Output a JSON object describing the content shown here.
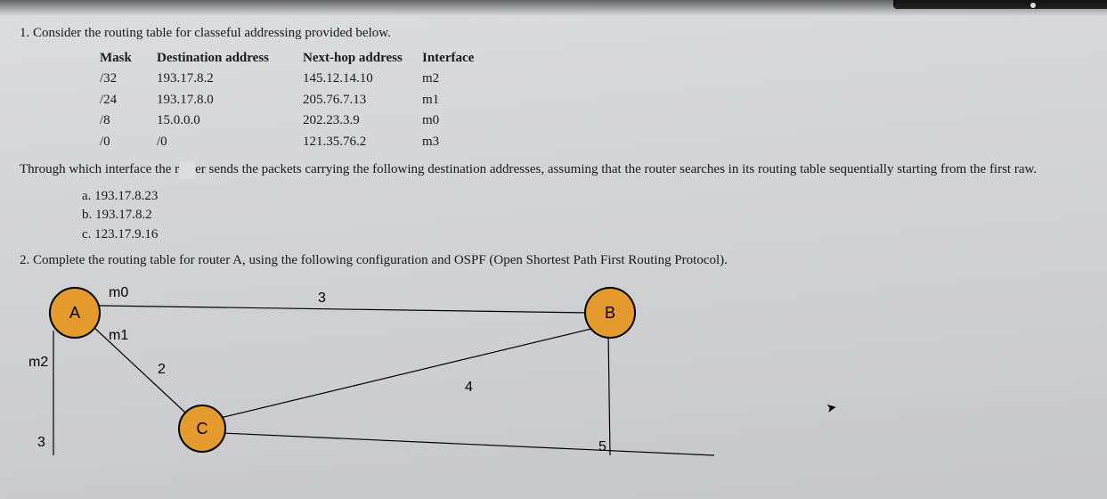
{
  "q1": {
    "number": "1.",
    "prompt": "Consider the routing table for classeful addressing provided below.",
    "headers": {
      "mask": "Mask",
      "dest": "Destination address",
      "next": "Next-hop address",
      "iface": "Interface"
    },
    "rows": [
      {
        "mask": "/32",
        "dest": "193.17.8.2",
        "next": "145.12.14.10",
        "iface": "m2"
      },
      {
        "mask": "/24",
        "dest": "193.17.8.0",
        "next": "205.76.7.13",
        "iface": "m1"
      },
      {
        "mask": "/8",
        "dest": "15.0.0.0",
        "next": "202.23.3.9",
        "iface": "m0"
      },
      {
        "mask": "/0",
        "dest": "/0",
        "next": "121.35.76.2",
        "iface": "m3"
      }
    ],
    "body_pre": "Through which interface the r",
    "body_post": "er sends the packets carrying the following destination addresses, assuming that the router searches in its routing table sequentially starting from the first raw.",
    "options": [
      {
        "label": "a.",
        "value": "193.17.8.23"
      },
      {
        "label": "b.",
        "value": "193.17.8.2"
      },
      {
        "label": "c.",
        "value": "123.17.9.16"
      }
    ]
  },
  "q2": {
    "number": "2.",
    "prompt": "Complete the routing table for router A, using the following configuration and OSPF (Open Shortest Path First Routing Protocol).",
    "nodes": {
      "A": "A",
      "B": "B",
      "C": "C"
    },
    "ifaces": {
      "m0": "m0",
      "m1": "m1",
      "m2": "m2"
    },
    "edge_weights": {
      "AB": "3",
      "AC": "2",
      "Aleft": "3",
      "CB": "4",
      "Bdown": "5"
    }
  }
}
